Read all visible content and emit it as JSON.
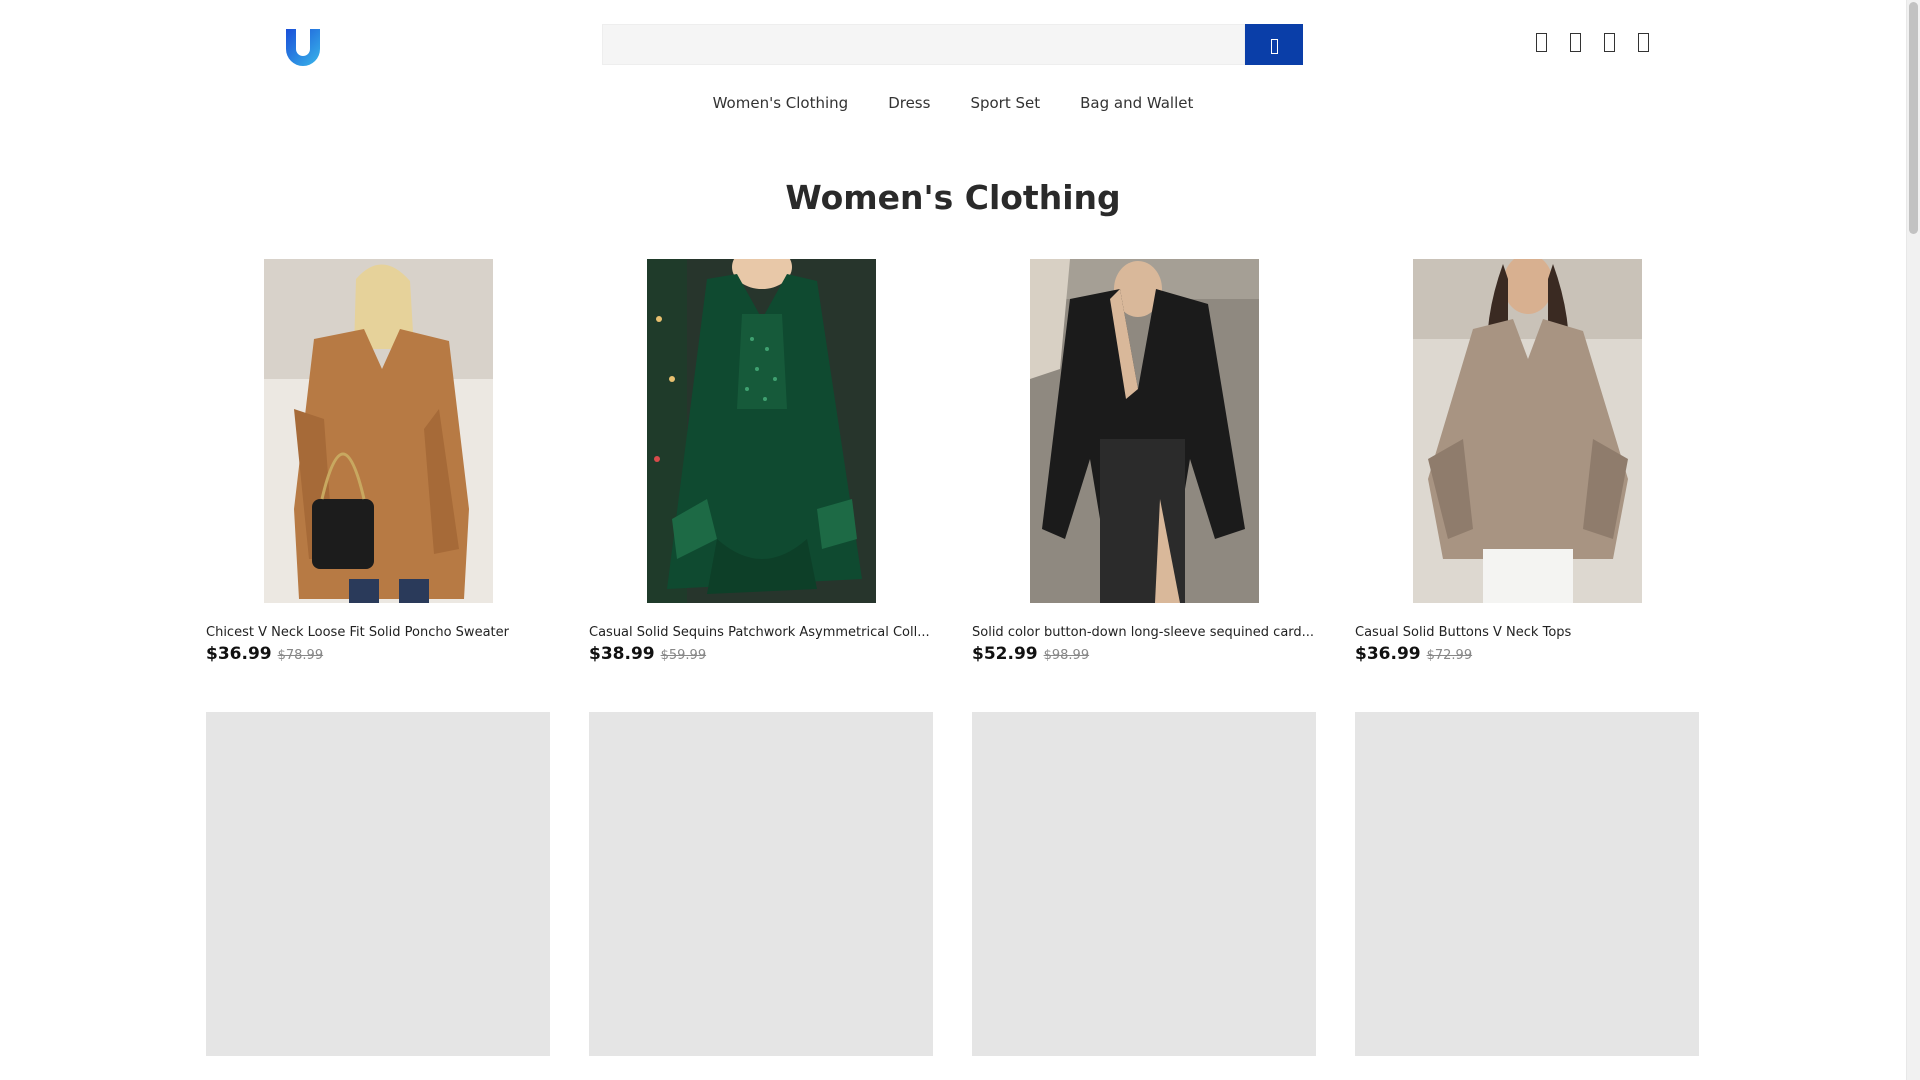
{
  "header": {
    "logo_icon": "u-logo-icon",
    "search": {
      "placeholder": "",
      "value": "",
      "button_icon": "search-icon"
    },
    "icons": [
      "user-icon",
      "heart-icon",
      "bag-icon",
      "cart-icon"
    ]
  },
  "nav": {
    "items": [
      "Women's Clothing",
      "Dress",
      "Sport Set",
      "Bag and Wallet"
    ]
  },
  "page_title": "Women's Clothing",
  "products": [
    {
      "name": "Chicest V Neck Loose Fit Solid Poncho Sweater",
      "price": "$36.99",
      "old_price": "$78.99",
      "image": "tan-poncho-sweater",
      "color": "#b77a44"
    },
    {
      "name": "Casual Solid Sequins Patchwork Asymmetrical Coll...",
      "price": "$38.99",
      "old_price": "$59.99",
      "image": "green-sequin-top",
      "color": "#0f4a30"
    },
    {
      "name": "Solid color button-down long-sleeve sequined card...",
      "price": "$52.99",
      "old_price": "$98.99",
      "image": "black-sequin-shirt",
      "color": "#1b1b1b"
    },
    {
      "name": "Casual Solid Buttons V Neck Tops",
      "price": "$36.99",
      "old_price": "$72.99",
      "image": "beige-knit-top",
      "color": "#a89482"
    },
    {
      "name": "",
      "price": "",
      "old_price": "",
      "image": "loading-placeholder"
    },
    {
      "name": "",
      "price": "",
      "old_price": "",
      "image": "loading-placeholder"
    },
    {
      "name": "",
      "price": "",
      "old_price": "",
      "image": "loading-placeholder"
    },
    {
      "name": "",
      "price": "",
      "old_price": "",
      "image": "loading-placeholder"
    }
  ],
  "colors": {
    "accent": "#0a3ea8",
    "placeholder": "#e5e5e5"
  }
}
